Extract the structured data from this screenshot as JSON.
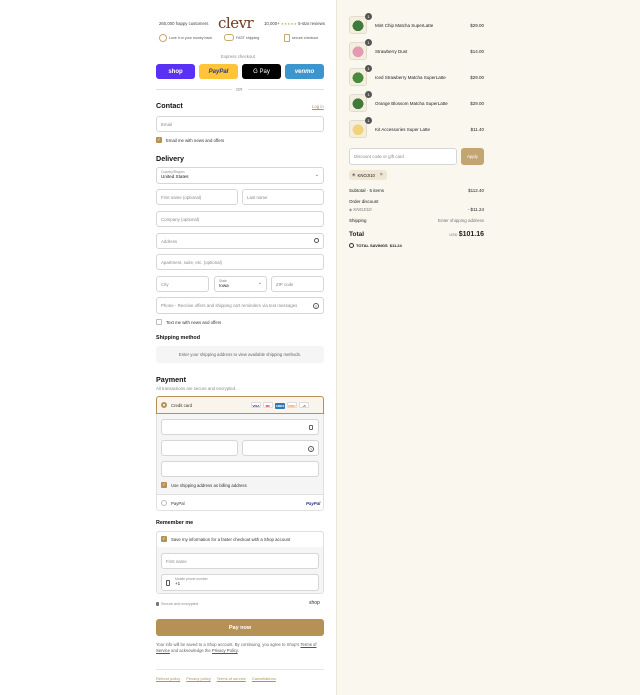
{
  "header": {
    "happy_customers": "260,000 happy customers",
    "logo": "clevr",
    "reviews_count": "10,000+",
    "reviews_label": "5-star reviews",
    "guarantee": "Love it or your money back",
    "shipping": "FAST shipping",
    "secure": "secure checkout"
  },
  "express": {
    "label": "Express checkout",
    "shop": "shop",
    "paypal": "PayPal",
    "gpay": "G Pay",
    "venmo": "venmo",
    "or": "OR"
  },
  "contact": {
    "title": "Contact",
    "login": "Log in",
    "email_placeholder": "Email",
    "newsletter": "Email me with news and offers"
  },
  "delivery": {
    "title": "Delivery",
    "country_label": "Country/Region",
    "country_value": "United States",
    "first_name": "First name (optional)",
    "last_name": "Last name",
    "company": "Company (optional)",
    "address": "Address",
    "apartment": "Apartment, suite, etc. (optional)",
    "city": "City",
    "state_label": "State",
    "state_value": "Iowa",
    "zip": "ZIP code",
    "phone": "Phone - Receive offers and shipping cart reminders via text messages",
    "text_me": "Text me with news and offers"
  },
  "shipping_method": {
    "title": "Shipping method",
    "message": "Enter your shipping address to view available shipping methods."
  },
  "payment": {
    "title": "Payment",
    "subtitle": "All transactions are secure and encrypted.",
    "credit_card": "Credit card",
    "cards": [
      "VISA",
      "MC",
      "AMEX",
      "DISC"
    ],
    "more_cards": "+5",
    "billing_same": "Use shipping address as billing address",
    "paypal": "PayPal",
    "paypal_logo": "PayPal"
  },
  "remember": {
    "title": "Remember me",
    "save_info": "Save my information for a faster checkout with a Shop account",
    "first_name": "First name",
    "mobile_label": "Mobile phone number",
    "mobile_value": "+1",
    "secure": "Secure and encrypted",
    "shop": "shop"
  },
  "pay_now": "Pay now",
  "disclaimer_1": "Your info will be saved to a Shop account. By continuing, you agree to Shop's",
  "terms_link": "Terms of Service",
  "disclaimer_2": "and acknowledge the",
  "privacy_link": "Privacy Policy",
  "footer": [
    "Refund policy",
    "Privacy policy",
    "Terms of service",
    "Cancellations"
  ],
  "cart": {
    "items": [
      {
        "qty": "1",
        "name": "Mint Chip Matcha SuperLatte",
        "price": "$29.00",
        "color": "#3f7a3a"
      },
      {
        "qty": "1",
        "name": "Strawberry Dust",
        "price": "$14.00",
        "color": "#e69ab0"
      },
      {
        "qty": "1",
        "name": "Iced Strawberry Matcha SuperLatte",
        "price": "$29.00",
        "color": "#4a8a3f"
      },
      {
        "qty": "1",
        "name": "Orange Blossom Matcha SuperLatte",
        "price": "$29.00",
        "color": "#3f7a3a"
      },
      {
        "qty": "1",
        "name": "Kit Accessories Super Latte",
        "price": "$11.40",
        "color": "#f2d37a"
      }
    ],
    "discount_placeholder": "Discount code or gift card",
    "apply": "Apply",
    "code": "KNOJI10",
    "subtotal_label": "Subtotal · 5 items",
    "subtotal": "$112.40",
    "order_discount": "Order discount",
    "discount_code": "KNOJI10",
    "discount_amount": "- $11.24",
    "shipping_label": "Shipping",
    "shipping_value": "Enter shipping address",
    "total_label": "Total",
    "currency": "USD",
    "total": "$101.16",
    "savings_label": "TOTAL SAVINGS",
    "savings": "$11.24"
  },
  "colors": {
    "accent": "#b69156",
    "shop": "#5a31f4",
    "paypal": "#ffc439",
    "venmo": "#3d95ce"
  }
}
